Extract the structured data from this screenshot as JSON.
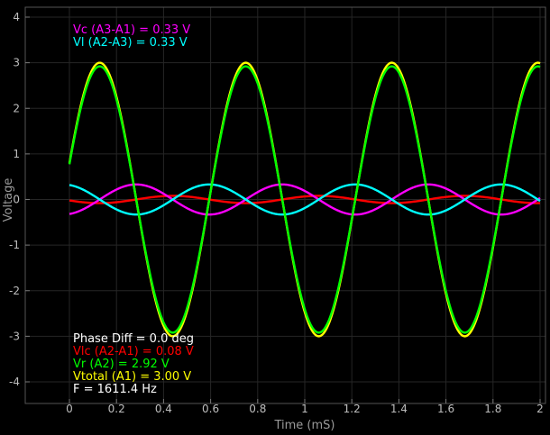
{
  "chart_data": {
    "type": "line",
    "title": "",
    "xlabel": "Time (mS)",
    "ylabel": "Voltage",
    "xlim": [
      0,
      2
    ],
    "ylim": [
      -4.3,
      4.3
    ],
    "x_ticks": [
      "0",
      "0.2",
      "0.4",
      "0.6",
      "0.8",
      "1",
      "1.2",
      "1.4",
      "1.6",
      "1.8",
      "2"
    ],
    "y_ticks": [
      "4",
      "3",
      "2",
      "1",
      "0",
      "-1",
      "-2",
      "-3",
      "-4"
    ],
    "grid": true,
    "frequency_hz": 1611.4,
    "series": [
      {
        "name": "Vtotal (A1)",
        "color": "#ffff00",
        "amplitude": 3.0,
        "phase_deg": 0
      },
      {
        "name": "Vr (A2)",
        "color": "#00ff00",
        "amplitude": 2.92,
        "phase_deg": 0
      },
      {
        "name": "Vc (A3-A1)",
        "color": "#ff00ff",
        "amplitude": 0.33,
        "phase_deg": -90
      },
      {
        "name": "Vl (A2-A3)",
        "color": "#00ffff",
        "amplitude": 0.33,
        "phase_deg": 90
      },
      {
        "name": "Vlc (A2-A1)",
        "color": "#ff0000",
        "amplitude": 0.08,
        "phase_deg": 180
      }
    ],
    "annotations_top": [
      {
        "text": "Vc (A3-A1) =  0.33 V",
        "color": "#ff00ff"
      },
      {
        "text": "Vl (A2-A3) =  0.33 V",
        "color": "#00ffff"
      }
    ],
    "annotations_bottom": [
      {
        "text": "Phase Diff =   0.0 deg",
        "color": "#ffffff"
      },
      {
        "text": "Vlc (A2-A1) =  0.08 V",
        "color": "#ff0000"
      },
      {
        "text": "Vr (A2) =  2.92 V",
        "color": "#00ff00"
      },
      {
        "text": "Vtotal (A1) =  3.00 V",
        "color": "#ffff00"
      },
      {
        "text": "F = 1611.4 Hz",
        "color": "#ffffff"
      }
    ]
  }
}
